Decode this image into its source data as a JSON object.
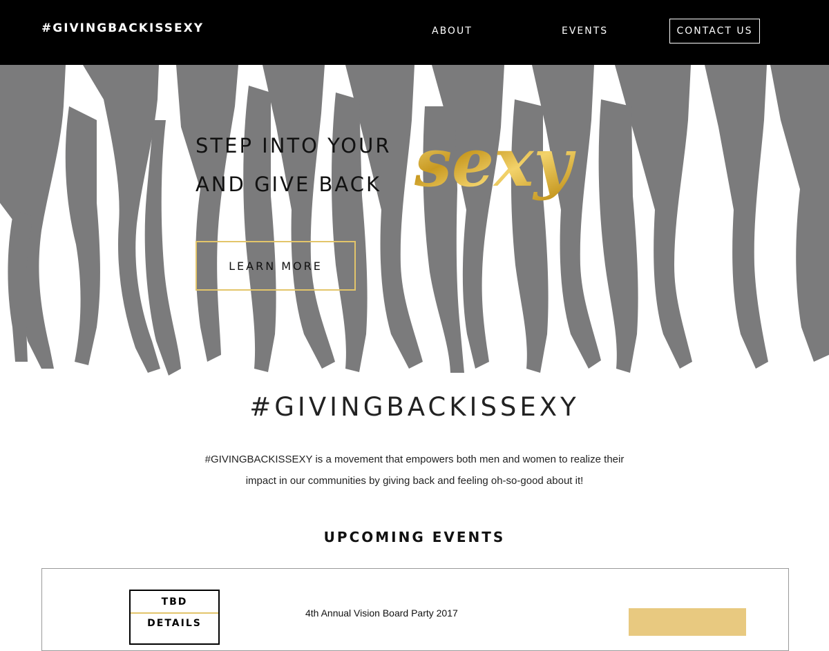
{
  "header": {
    "brand": "#GIVINGBACKISSEXY",
    "nav": {
      "about": "ABOUT",
      "events": "EVENTS",
      "contact": "CONTACT US"
    }
  },
  "hero": {
    "line1": "STEP INTO YOUR",
    "line2": "AND GIVE BACK",
    "script_word": "sexy",
    "button": "LEARN MORE"
  },
  "intro": {
    "heading": "#GIVINGBACKISSEXY",
    "text": "#GIVINGBACKISSEXY is a movement that empowers both men and women to realize their impact in our communities by giving back and feeling oh-so-good about it!"
  },
  "events": {
    "heading": "UPCOMING EVENTS",
    "items": [
      {
        "date_top": "TBD",
        "date_bottom": "DETAILS",
        "title": "4th Annual Vision Board Party 2017"
      }
    ]
  },
  "colors": {
    "header_bg": "#000000",
    "silhouette": "#7b7b7c",
    "accent_gold": "#e3c56a",
    "button_gold": "#e8c980"
  },
  "icons": {
    "hero_art": "silhouettes-of-legs-in-heels-image",
    "script_word_style": "gold-foil-script-text"
  }
}
